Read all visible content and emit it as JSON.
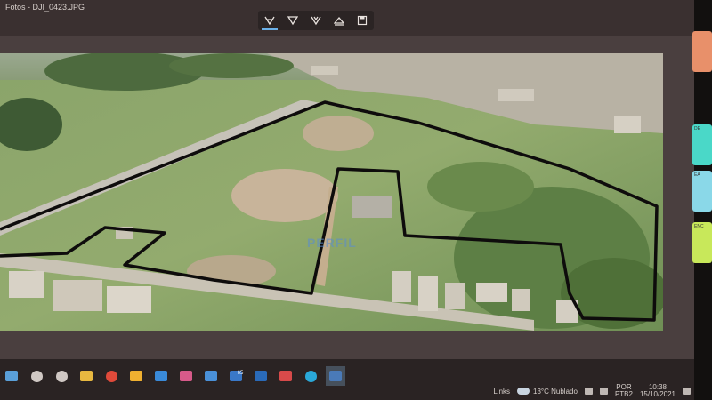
{
  "window": {
    "title": "Fotos - DJI_0423.JPG"
  },
  "toolbar": {
    "tools": [
      {
        "name": "draw-tool-1-icon",
        "active": true
      },
      {
        "name": "draw-tool-2-icon",
        "active": false
      },
      {
        "name": "draw-tool-3-icon",
        "active": false
      },
      {
        "name": "eraser-icon",
        "active": false
      },
      {
        "name": "save-icon",
        "active": false
      }
    ]
  },
  "photo": {
    "watermark": "PERFIL"
  },
  "taskbar": {
    "links_label": "Links",
    "weather": "13°C  Nublado",
    "language_top": "POR",
    "language_bottom": "PTB2",
    "time": "10:38",
    "date": "15/10/2021",
    "mail_badge": "65",
    "app_icons": [
      {
        "name": "windows-start-icon",
        "color": "#5a9fd8"
      },
      {
        "name": "search-icon",
        "color": "#d0c8c4"
      },
      {
        "name": "task-view-icon",
        "color": "#d0c8c4"
      },
      {
        "name": "file-explorer-icon",
        "color": "#e8b840"
      },
      {
        "name": "chrome-icon",
        "color": "#e04a3a"
      },
      {
        "name": "chrome-alt-icon",
        "color": "#f0b030"
      },
      {
        "name": "photos-app-icon",
        "color": "#3a8ad8"
      },
      {
        "name": "paint-icon",
        "color": "#d85a8a"
      },
      {
        "name": "calendar-icon",
        "color": "#4a90d8"
      },
      {
        "name": "mail-icon",
        "color": "#3a78c8"
      },
      {
        "name": "outlook-icon",
        "color": "#2a6ab8"
      },
      {
        "name": "maps-icon",
        "color": "#d84a4a"
      },
      {
        "name": "edge-icon",
        "color": "#2aa8d8"
      },
      {
        "name": "photo-viewer-icon",
        "color": "#4a7ab8"
      }
    ]
  },
  "sticky_notes": [
    {
      "color": "#e8906a",
      "text": ""
    },
    {
      "color": "#4ad8c8",
      "text": "DE"
    },
    {
      "color": "#8ad8e8",
      "text": "EA"
    },
    {
      "color": "#c8e85a",
      "text": "ENC"
    }
  ]
}
